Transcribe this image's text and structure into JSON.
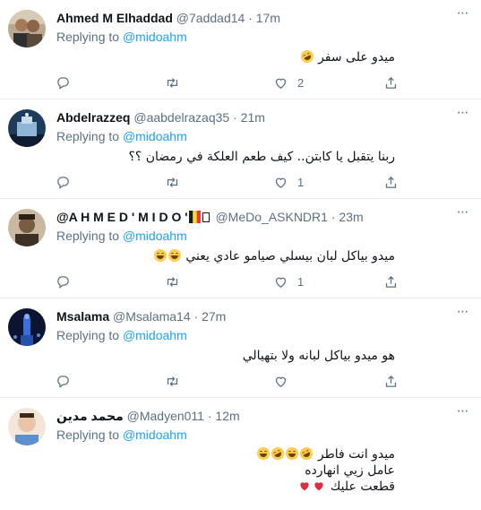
{
  "tweets": [
    {
      "display_name": "Ahmed M Elhaddad",
      "handle": "@7addad14",
      "time": "17m",
      "reply_prefix": "Replying to",
      "reply_to": "@midoahm",
      "lines": [
        "ميدو على سفر"
      ],
      "replies": "",
      "retweets": "",
      "likes": "2",
      "avatar_colors": [
        "#b9a78e",
        "#5a4a3a"
      ]
    },
    {
      "display_name": "Abdelrazzeq",
      "handle": "@aabdelrazaq35",
      "time": "21m",
      "reply_prefix": "Replying to",
      "reply_to": "@midoahm",
      "lines": [
        "ربنا يتقبل يا كابتن.. كيف طعم العلكة في رمضان ؟؟"
      ],
      "replies": "",
      "retweets": "",
      "likes": "1",
      "avatar_colors": [
        "#1e3b5c",
        "#8fb6d6"
      ]
    },
    {
      "display_name": "@A H M E D ' M I D O '",
      "handle": "@MeDo_ASKNDR1",
      "time": "23m",
      "reply_prefix": "Replying to",
      "reply_to": "@midoahm",
      "lines": [
        "ميدو بياكل لبان بيسلي صيامو عادي يعني"
      ],
      "replies": "",
      "retweets": "",
      "likes": "1",
      "avatar_colors": [
        "#c9b9a0",
        "#3c3024"
      ]
    },
    {
      "display_name": "Msalama",
      "handle": "@Msalama14",
      "time": "27m",
      "reply_prefix": "Replying to",
      "reply_to": "@midoahm",
      "lines": [
        "هو ميدو بياكل لبانه ولا بتهيالي"
      ],
      "replies": "",
      "retweets": "",
      "likes": "",
      "avatar_colors": [
        "#0b1530",
        "#3a6fd8"
      ]
    },
    {
      "display_name": "محمد مدين",
      "handle": "@Madyen011",
      "time": "12m",
      "reply_prefix": "Replying to",
      "reply_to": "@midoahm",
      "lines": [
        "ميدو انت فاطر",
        "عامل زيي انهارده",
        "قطعت عليك"
      ],
      "replies": "",
      "retweets": "",
      "likes": "",
      "avatar_colors": [
        "#e9c4a8",
        "#5b8fcf"
      ]
    }
  ],
  "sep": "·",
  "more_glyph": "···"
}
